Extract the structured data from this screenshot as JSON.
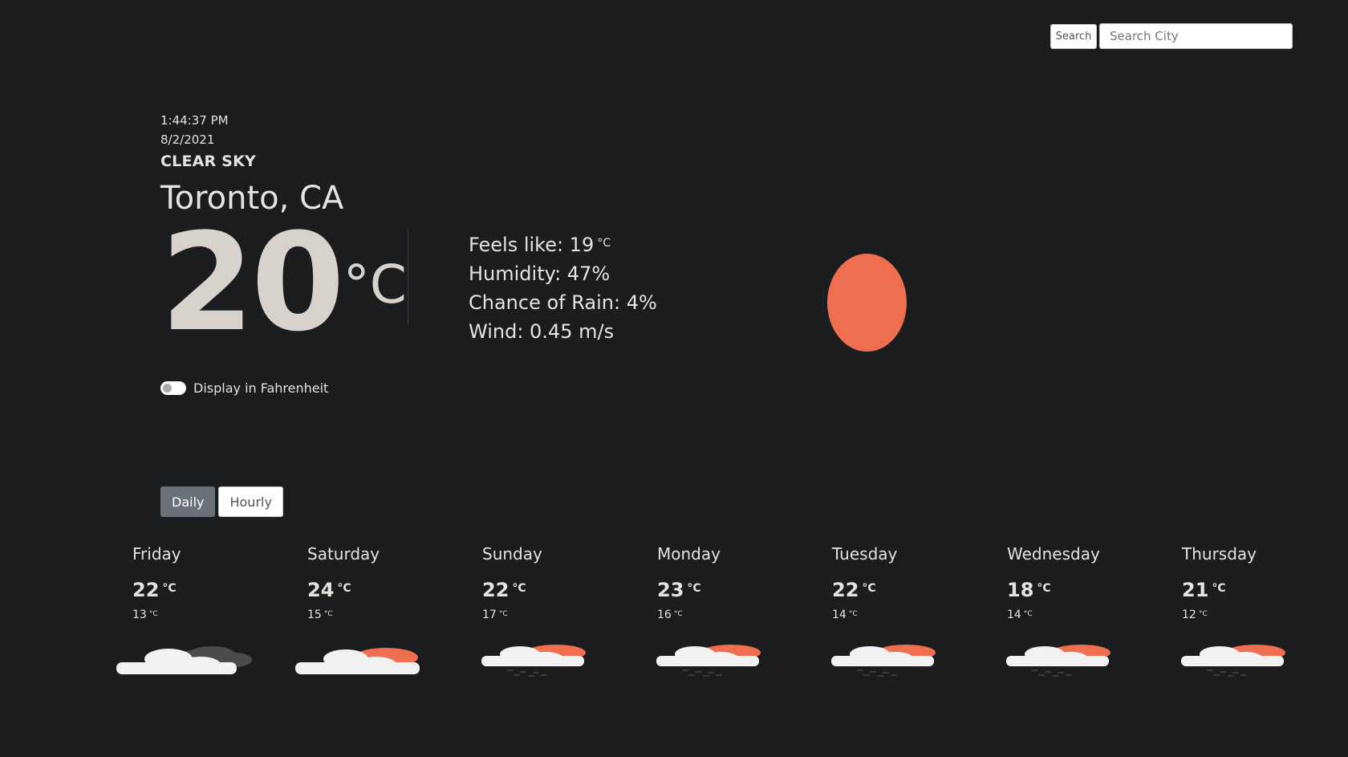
{
  "search": {
    "button_label": "Search",
    "placeholder": "Search City"
  },
  "current": {
    "time": "1:44:37 PM",
    "date": "8/2/2021",
    "description": "CLEAR SKY",
    "city": "Toronto, CA",
    "temperature": "20",
    "unit": "°C",
    "icon": "sun-icon",
    "feels_like_label": "Feels like: 19",
    "feels_like_unit": "°C",
    "humidity": "Humidity: 47%",
    "rain": "Chance of Rain: 4%",
    "wind": "Wind: 0.45 m/s"
  },
  "toggle": {
    "label": "Display in Fahrenheit",
    "on": false
  },
  "view": {
    "daily_label": "Daily",
    "hourly_label": "Hourly",
    "selected": "Daily"
  },
  "colors": {
    "background": "#1b1c1e",
    "sun": "#ee6e50",
    "active_button": "#6b7178"
  },
  "forecast": [
    {
      "day": "Friday",
      "high": "22",
      "low": "13",
      "unit": "°C",
      "icon": "cloudy-icon"
    },
    {
      "day": "Saturday",
      "high": "24",
      "low": "15",
      "unit": "°C",
      "icon": "partly-cloudy-icon"
    },
    {
      "day": "Sunday",
      "high": "22",
      "low": "17",
      "unit": "°C",
      "icon": "rain-sun-icon"
    },
    {
      "day": "Monday",
      "high": "23",
      "low": "16",
      "unit": "°C",
      "icon": "rain-sun-icon"
    },
    {
      "day": "Tuesday",
      "high": "22",
      "low": "14",
      "unit": "°C",
      "icon": "rain-sun-icon"
    },
    {
      "day": "Wednesday",
      "high": "18",
      "low": "14",
      "unit": "°C",
      "icon": "rain-sun-icon"
    },
    {
      "day": "Thursday",
      "high": "21",
      "low": "12",
      "unit": "°C",
      "icon": "rain-sun-icon"
    }
  ]
}
